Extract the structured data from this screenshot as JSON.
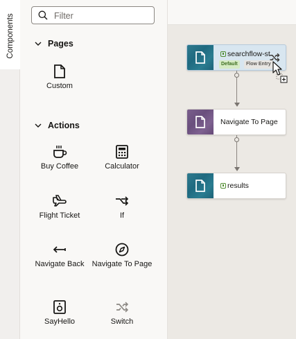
{
  "tab": {
    "label": "Components"
  },
  "search": {
    "placeholder": "Filter"
  },
  "sections": {
    "pages": {
      "title": "Pages",
      "items": [
        {
          "label": "Custom",
          "icon": "page-icon"
        }
      ]
    },
    "actions": {
      "title": "Actions",
      "items": [
        {
          "label": "Buy Coffee",
          "icon": "coffee-icon"
        },
        {
          "label": "Calculator",
          "icon": "calculator-icon"
        },
        {
          "label": "Flight Ticket",
          "icon": "airplane-icon"
        },
        {
          "label": "If",
          "icon": "branch-icon"
        },
        {
          "label": "Navigate Back",
          "icon": "back-arrow-icon"
        },
        {
          "label": "Navigate To Page",
          "icon": "compass-icon"
        },
        {
          "label": "SayHello",
          "icon": "speaker-icon"
        },
        {
          "label": "Switch",
          "icon": "switch-icon"
        }
      ]
    }
  },
  "flow": {
    "nodes": [
      {
        "title": "searchflow-st",
        "badges": [
          "Default",
          "Flow Entry"
        ],
        "selected": true,
        "color": "#2f7a8e"
      },
      {
        "title": "Navigate To Page",
        "badges": [],
        "selected": false,
        "color": "#7a5e8c"
      },
      {
        "title": "results",
        "badges": [],
        "selected": false,
        "color": "#2f7a8e"
      }
    ]
  },
  "colors": {
    "accent": "#2f7a8e",
    "selected": "#d8e6f0",
    "canvas": "#ece9e4"
  }
}
